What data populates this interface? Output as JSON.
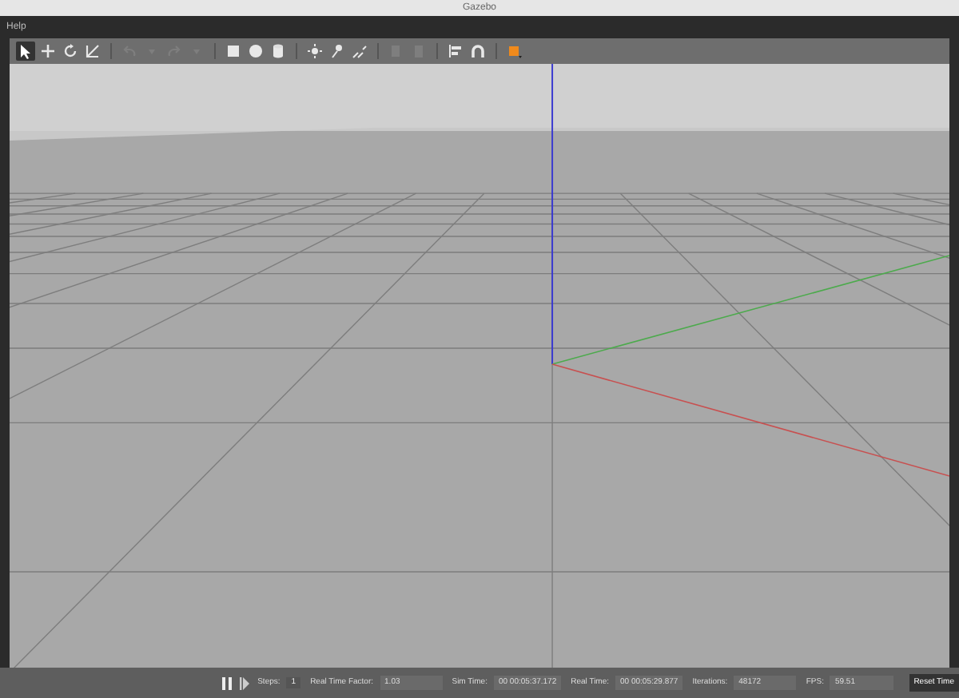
{
  "window": {
    "title": "Gazebo"
  },
  "menu": [
    "Help"
  ],
  "toolbar": [
    {
      "kind": "select",
      "selected": true,
      "disabled": false
    },
    {
      "kind": "move",
      "selected": false,
      "disabled": false
    },
    {
      "kind": "rotate",
      "selected": false,
      "disabled": false
    },
    {
      "kind": "scale",
      "selected": false,
      "disabled": false
    },
    {
      "kind": "sep"
    },
    {
      "kind": "undo",
      "selected": false,
      "disabled": true
    },
    {
      "kind": "undo-list",
      "selected": false,
      "disabled": true
    },
    {
      "kind": "redo",
      "selected": false,
      "disabled": true
    },
    {
      "kind": "redo-list",
      "selected": false,
      "disabled": true
    },
    {
      "kind": "sep"
    },
    {
      "kind": "box",
      "selected": false,
      "disabled": false
    },
    {
      "kind": "sphere",
      "selected": false,
      "disabled": false
    },
    {
      "kind": "cylinder",
      "selected": false,
      "disabled": false
    },
    {
      "kind": "sep"
    },
    {
      "kind": "sun",
      "selected": false,
      "disabled": false
    },
    {
      "kind": "spot",
      "selected": false,
      "disabled": false
    },
    {
      "kind": "beam",
      "selected": false,
      "disabled": false
    },
    {
      "kind": "sep"
    },
    {
      "kind": "copy",
      "selected": false,
      "disabled": true
    },
    {
      "kind": "paste",
      "selected": false,
      "disabled": true
    },
    {
      "kind": "sep"
    },
    {
      "kind": "align",
      "selected": false,
      "disabled": false
    },
    {
      "kind": "magnet",
      "selected": false,
      "disabled": false
    },
    {
      "kind": "sep"
    },
    {
      "kind": "color",
      "selected": false,
      "disabled": false
    }
  ],
  "status_bar": {
    "steps_label": "Steps:",
    "steps_value": "1",
    "fields": [
      {
        "label": "Real Time Factor:",
        "value": "1.03"
      },
      {
        "label": "Sim Time:",
        "value": "00 00:05:37.172"
      },
      {
        "label": "Real Time:",
        "value": "00 00:05:29.877"
      },
      {
        "label": "Iterations:",
        "value": "48172"
      },
      {
        "label": "FPS:",
        "value": "59.51"
      }
    ],
    "reset_button": "Reset Time"
  }
}
